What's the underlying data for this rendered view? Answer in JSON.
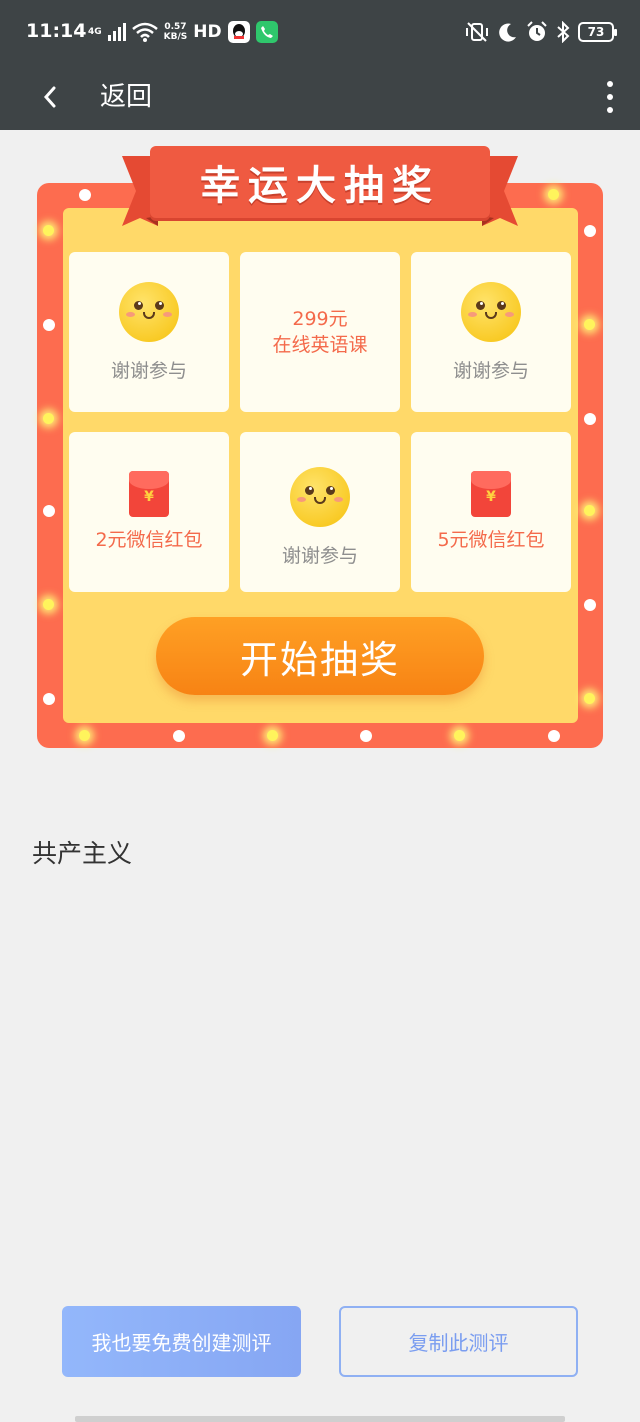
{
  "status_bar": {
    "time": "11:14",
    "network": "4G",
    "speed_value": "0.57",
    "speed_unit": "KB/S",
    "hd": "HD",
    "battery": "73"
  },
  "app_bar": {
    "back_label": "返回"
  },
  "lottery": {
    "title": "幸运大抽奖",
    "prizes": [
      {
        "type": "smiley",
        "label": "谢谢参与"
      },
      {
        "type": "text",
        "line1": "299元",
        "line2": "在线英语课"
      },
      {
        "type": "smiley",
        "label": "谢谢参与"
      },
      {
        "type": "hongbao",
        "label": "2元微信红包"
      },
      {
        "type": "smiley",
        "label": "谢谢参与"
      },
      {
        "type": "hongbao",
        "label": "5元微信红包"
      }
    ],
    "yen_symbol": "¥",
    "start_button": "开始抽奖"
  },
  "content": {
    "caption": "共产主义"
  },
  "actions": {
    "create_label": "我也要免费创建测评",
    "copy_label": "复制此测评"
  },
  "colors": {
    "header_bg": "#3e4446",
    "frame_red": "#fd6c4f",
    "panel_yellow": "#ffd969",
    "prize_red": "#f46a4b",
    "button_orange": "#f78314",
    "action_blue": "#86a6f3"
  }
}
